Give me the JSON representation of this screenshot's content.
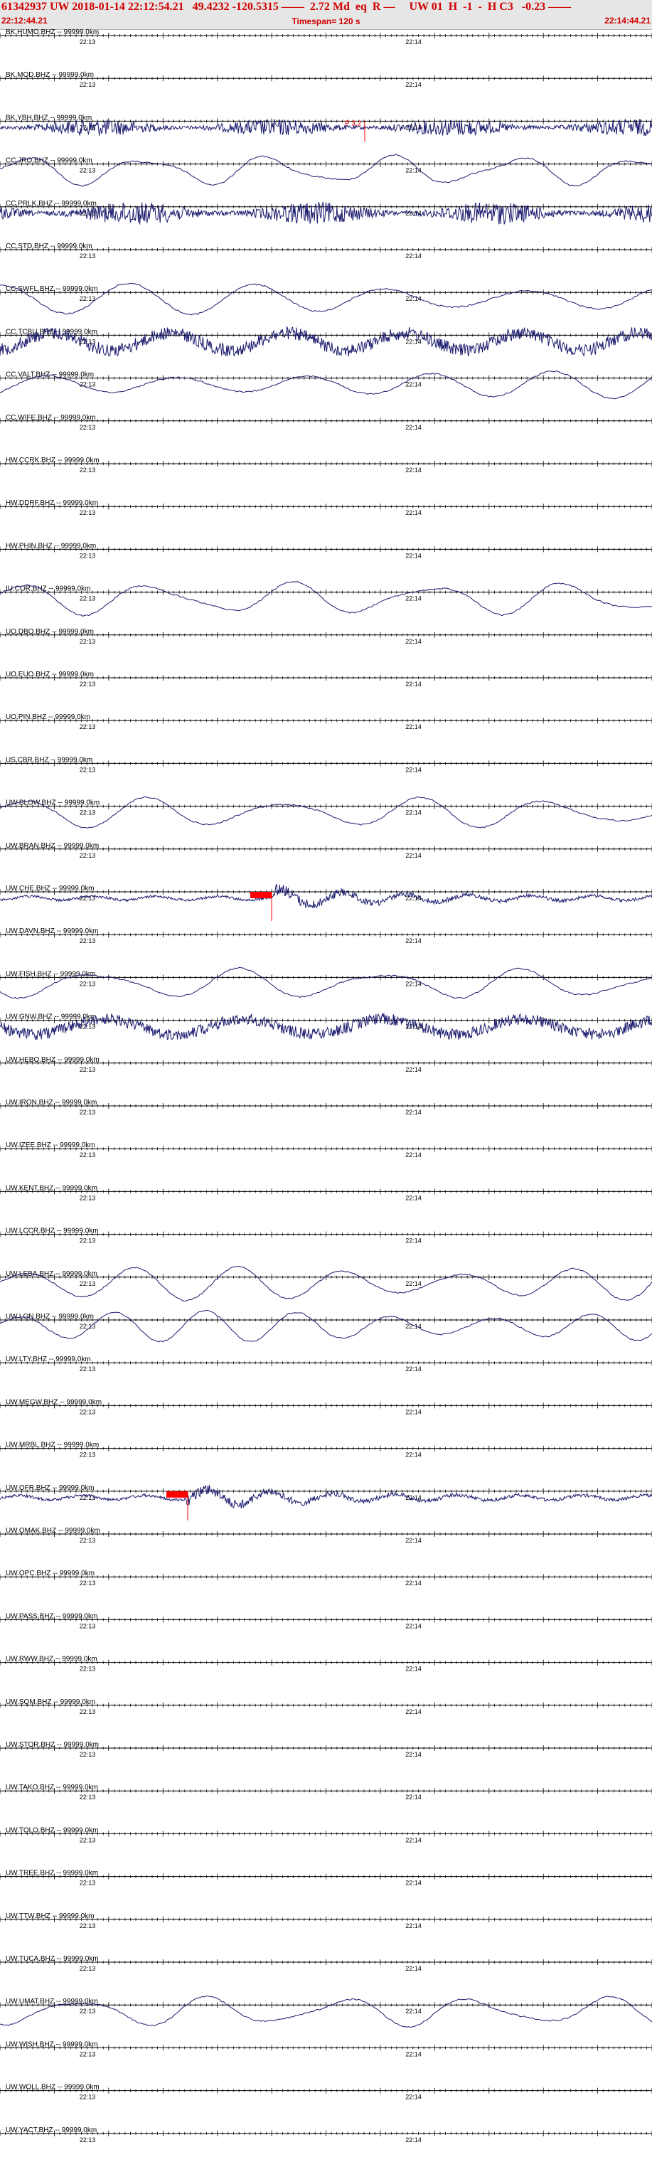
{
  "header": {
    "title": "61342937 UW 2018-01-14 22:12:54.21   49.4232 -120.5315 ——  2.72 Md  eq  R —     UW 01  H  -1  -  H C3   -0.23 ——",
    "start_time": "22:12:44.21",
    "timespan": "Timespan= 120 s",
    "end_time": "22:14:44.21"
  },
  "colors": {
    "header_text": "#d10000",
    "trace": "#1a1a6e",
    "pick": "#ff0000",
    "axis": "#000000",
    "header_bg": "#e6e6e6"
  },
  "chart_data": {
    "type": "line",
    "title": "61342937 UW 2018-01-14 22:12:54.21   49.4232 -120.5315 ——  2.72 Md  eq  R —     UW 01  H  -1  -  H C3   -0.23 ——",
    "xlabel": "",
    "ylabel": "",
    "x_range_s": [
      0,
      120
    ],
    "minute_tick_labels": [
      "22:13",
      "22:14"
    ],
    "grid": false,
    "series": [
      {
        "name": "BK.HUMO.BHZ -- 99999.0km",
        "signal": "flat"
      },
      {
        "name": "BK.MOD.BHZ -- 99999.0km",
        "signal": "flat"
      },
      {
        "name": "BK.YBH.BHZ -- 99999.0km",
        "signal": "noise",
        "amplitude": 12,
        "pick_label": "P 3.2"
      },
      {
        "name": "CC.JRO.BHZ -- 99999.0km",
        "signal": "wave",
        "amplitude": 22
      },
      {
        "name": "CC.PRLK.BHZ -- 99999.0km",
        "signal": "noise",
        "amplitude": 16
      },
      {
        "name": "CC.STD.BHZ -- 99999.0km",
        "signal": "flat"
      },
      {
        "name": "CC.SWFL.BHZ -- 99999.0km",
        "signal": "wave",
        "amplitude": 22
      },
      {
        "name": "CC.TCBU.BHZ -- 99999.0km",
        "signal": "noisywave",
        "amplitude": 20
      },
      {
        "name": "CC.VALT.BHZ -- 99999.0km",
        "signal": "wave",
        "amplitude": 20
      },
      {
        "name": "CC.WIFE.BHZ -- 99999.0km",
        "signal": "flat"
      },
      {
        "name": "HW.CCRK.BHZ -- 99999.0km",
        "signal": "flat"
      },
      {
        "name": "HW.DDRF.BHZ -- 99999.0km",
        "signal": "flat"
      },
      {
        "name": "HW.PHIN.BHZ -- 99999.0km",
        "signal": "flat"
      },
      {
        "name": "IU.COR.BHZ -- 99999.0km",
        "signal": "wave",
        "amplitude": 24
      },
      {
        "name": "UO.DBO.BHZ -- 99999.0km",
        "signal": "flat"
      },
      {
        "name": "UO.EUO.BHZ -- 99999.0km",
        "signal": "flat"
      },
      {
        "name": "UO.PIN.BHZ -- 99999.0km",
        "signal": "flat"
      },
      {
        "name": "US.CBR.BHZ -- 99999.0km",
        "signal": "flat"
      },
      {
        "name": "UW.BLOW.BHZ -- 99999.0km",
        "signal": "wave",
        "amplitude": 22
      },
      {
        "name": "UW.BRAN.BHZ -- 99999.0km",
        "signal": "flat"
      },
      {
        "name": "UW.CHE.BHZ -- 99999.0km",
        "signal": "event",
        "amplitude": 18,
        "pick": true
      },
      {
        "name": "UW.DAVN.BHZ -- 99999.0km",
        "signal": "flat"
      },
      {
        "name": "UW.FISH.BHZ -- 99999.0km",
        "signal": "wave",
        "amplitude": 22
      },
      {
        "name": "UW.GNW.BHZ -- 99999.0km",
        "signal": "noisywave",
        "amplitude": 18
      },
      {
        "name": "UW.HEBO.BHZ -- 99999.0km",
        "signal": "flat"
      },
      {
        "name": "UW.IRON.BHZ -- 99999.0km",
        "signal": "flat"
      },
      {
        "name": "UW.IZEE.BHZ -- 99999.0km",
        "signal": "flat"
      },
      {
        "name": "UW.KENT.BHZ -- 99999.0km",
        "signal": "flat"
      },
      {
        "name": "UW.LCCR.BHZ -- 99999.0km",
        "signal": "flat"
      },
      {
        "name": "UW.LEBA.BHZ -- 99999.0km",
        "signal": "wave",
        "amplitude": 24
      },
      {
        "name": "UW.LON.BHZ -- 99999.0km",
        "signal": "wave",
        "amplitude": 22
      },
      {
        "name": "UW.LTY.BHZ -- 99999.0km",
        "signal": "flat"
      },
      {
        "name": "UW.MEGW.BHZ -- 99999.0km",
        "signal": "flat"
      },
      {
        "name": "UW.MRBL.BHZ -- 99999.0km",
        "signal": "flat"
      },
      {
        "name": "UW.OFR.BHZ -- 99999.0km",
        "signal": "event",
        "amplitude": 20,
        "pick": true
      },
      {
        "name": "UW.OMAK.BHZ -- 99999.0km",
        "signal": "flat"
      },
      {
        "name": "UW.OPC.BHZ -- 99999.0km",
        "signal": "flat"
      },
      {
        "name": "UW.PASS.BHZ -- 99999.0km",
        "signal": "flat"
      },
      {
        "name": "UW.RWW.BHZ -- 99999.0km",
        "signal": "flat"
      },
      {
        "name": "UW.SQM.BHZ -- 99999.0km",
        "signal": "flat"
      },
      {
        "name": "UW.STOR.BHZ -- 99999.0km",
        "signal": "flat"
      },
      {
        "name": "UW.TAKO.BHZ -- 99999.0km",
        "signal": "flat"
      },
      {
        "name": "UW.TOLO.BHZ -- 99999.0km",
        "signal": "flat"
      },
      {
        "name": "UW.TREE.BHZ -- 99999.0km",
        "signal": "flat"
      },
      {
        "name": "UW.TTW.BHZ -- 99999.0km",
        "signal": "flat"
      },
      {
        "name": "UW.TUCA.BHZ -- 99999.0km",
        "signal": "flat"
      },
      {
        "name": "UW.UMAT.BHZ -- 99999.0km",
        "signal": "wave",
        "amplitude": 22
      },
      {
        "name": "UW.WISH.BHZ -- 99999.0km",
        "signal": "flat"
      },
      {
        "name": "UW.WOLL.BHZ -- 99999.0km",
        "signal": "flat"
      },
      {
        "name": "UW.YACT.BHZ -- 99999.0km",
        "signal": "flat"
      }
    ]
  }
}
